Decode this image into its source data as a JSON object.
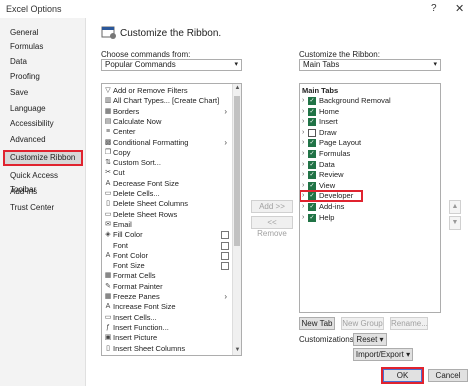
{
  "window": {
    "title": "Excel Options",
    "help": "?",
    "close": "✕"
  },
  "nav": {
    "items": [
      "General",
      "Formulas",
      "Data",
      "Proofing",
      "Save",
      "Language",
      "Accessibility",
      "Advanced",
      "Customize Ribbon",
      "Quick Access Toolbar",
      "Add-ins",
      "Trust Center"
    ],
    "selected": "Customize Ribbon"
  },
  "heading": "Customize the Ribbon.",
  "left": {
    "label": "Choose commands from:",
    "combo_value": "Popular Commands",
    "commands": [
      {
        "label": "Add or Remove Filters",
        "icon": "filter-icon"
      },
      {
        "label": "All Chart Types... [Create Chart]",
        "icon": "chart-icon"
      },
      {
        "label": "Borders",
        "icon": "borders-icon",
        "sub": "›"
      },
      {
        "label": "Calculate Now",
        "icon": "calculator-icon"
      },
      {
        "label": "Center",
        "icon": "center-icon"
      },
      {
        "label": "Conditional Formatting",
        "icon": "conditional-icon",
        "sub": "›"
      },
      {
        "label": "Copy",
        "icon": "copy-icon"
      },
      {
        "label": "Custom Sort...",
        "icon": "sort-icon"
      },
      {
        "label": "Cut",
        "icon": "cut-icon"
      },
      {
        "label": "Decrease Font Size",
        "icon": "font-decrease-icon"
      },
      {
        "label": "Delete Cells...",
        "icon": "delete-cells-icon"
      },
      {
        "label": "Delete Sheet Columns",
        "icon": "delete-columns-icon"
      },
      {
        "label": "Delete Sheet Rows",
        "icon": "delete-rows-icon"
      },
      {
        "label": "Email",
        "icon": "email-icon"
      },
      {
        "label": "Fill Color",
        "icon": "fill-color-icon",
        "box": true
      },
      {
        "label": "Font",
        "icon": "",
        "box": true
      },
      {
        "label": "Font Color",
        "icon": "font-color-icon",
        "box": true
      },
      {
        "label": "Font Size",
        "icon": "",
        "box": true
      },
      {
        "label": "Format Cells",
        "icon": "format-cells-icon"
      },
      {
        "label": "Format Painter",
        "icon": "format-painter-icon"
      },
      {
        "label": "Freeze Panes",
        "icon": "freeze-icon",
        "sub": "›"
      },
      {
        "label": "Increase Font Size",
        "icon": "font-increase-icon"
      },
      {
        "label": "Insert Cells...",
        "icon": "insert-cells-icon"
      },
      {
        "label": "Insert Function...",
        "icon": "function-icon"
      },
      {
        "label": "Insert Picture",
        "icon": "picture-icon"
      },
      {
        "label": "Insert Sheet Columns",
        "icon": "insert-columns-icon"
      }
    ]
  },
  "middle": {
    "add": "Add >>",
    "remove": "<< Remove"
  },
  "right": {
    "label": "Customize the Ribbon:",
    "combo_value": "Main Tabs",
    "header": "Main Tabs",
    "tabs": [
      {
        "label": "Background Removal",
        "checked": true
      },
      {
        "label": "Home",
        "checked": true
      },
      {
        "label": "Insert",
        "checked": true
      },
      {
        "label": "Draw",
        "checked": false
      },
      {
        "label": "Page Layout",
        "checked": true
      },
      {
        "label": "Formulas",
        "checked": true
      },
      {
        "label": "Data",
        "checked": true
      },
      {
        "label": "Review",
        "checked": true
      },
      {
        "label": "View",
        "checked": true
      },
      {
        "label": "Developer",
        "checked": true
      },
      {
        "label": "Add-ins",
        "checked": true
      },
      {
        "label": "Help",
        "checked": true
      }
    ],
    "highlighted": "Developer",
    "new_tab": "New Tab",
    "new_group": "New Group",
    "rename": "Rename...",
    "customizations_label": "Customizations:",
    "reset": "Reset ▾",
    "import_export": "Import/Export ▾"
  },
  "footer": {
    "ok": "OK",
    "cancel": "Cancel"
  },
  "colors": {
    "accent_red": "#e0232f",
    "check_green": "#217346"
  }
}
